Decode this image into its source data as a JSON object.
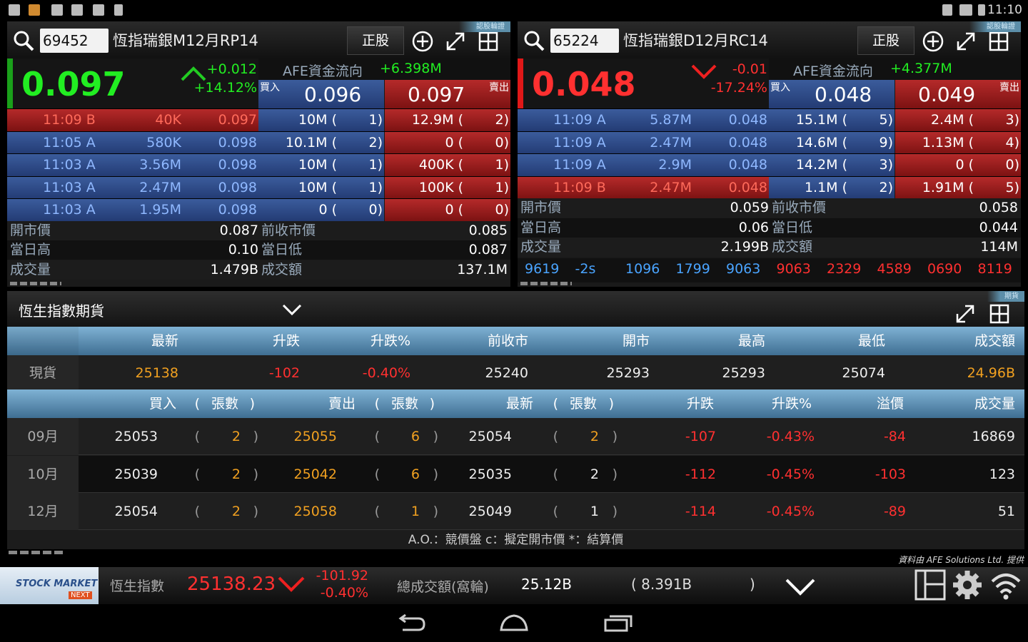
{
  "status_bar": {
    "time": "11:10"
  },
  "panels": [
    {
      "code": "69452",
      "name": "恆指瑞銀M12月RP14",
      "button": "正股",
      "tag": "認股輪證",
      "price": "0.097",
      "change": "+0.012",
      "change_pct": "+14.12%",
      "afe_label": "AFE資金流向",
      "afe_value": "+6.398M",
      "bid_label": "買入",
      "ask_label": "賣出",
      "bid": "0.096",
      "ask": "0.097",
      "trades": [
        {
          "time": "11:09 B",
          "vol": "40K",
          "price": "0.097",
          "side": "red"
        },
        {
          "time": "11:05 A",
          "vol": "580K",
          "price": "0.098",
          "side": "blue"
        },
        {
          "time": "11:03 A",
          "vol": "3.56M",
          "price": "0.098",
          "side": "blue"
        },
        {
          "time": "11:03 A",
          "vol": "2.47M",
          "price": "0.098",
          "side": "blue"
        },
        {
          "time": "11:03 A",
          "vol": "1.95M",
          "price": "0.098",
          "side": "blue"
        }
      ],
      "bids": [
        [
          "10M (",
          "1)"
        ],
        [
          "10.1M (",
          "2)"
        ],
        [
          "10M (",
          "1)"
        ],
        [
          "10M (",
          "1)"
        ],
        [
          "0 (",
          "0)"
        ]
      ],
      "asks": [
        [
          "12.9M (",
          "2)"
        ],
        [
          "0 (",
          "0)"
        ],
        [
          "400K (",
          "1)"
        ],
        [
          "100K (",
          "1)"
        ],
        [
          "0 (",
          "0)"
        ]
      ],
      "stats": [
        {
          "l1": "開市價",
          "v1": "0.087",
          "l2": "前收市價",
          "v2": "0.085"
        },
        {
          "l1": "當日高",
          "v1": "0.10",
          "l2": "當日低",
          "v2": "0.087"
        },
        {
          "l1": "成交量",
          "v1": "1.479B",
          "l2": "成交額",
          "v2": "137.1M"
        }
      ]
    },
    {
      "code": "65224",
      "name": "恆指瑞銀D12月RC14",
      "button": "正股",
      "tag": "認股輪證",
      "price": "0.048",
      "change": "-0.01",
      "change_pct": "-17.24%",
      "afe_label": "AFE資金流向",
      "afe_value": "+4.377M",
      "bid_label": "買入",
      "ask_label": "賣出",
      "bid": "0.048",
      "ask": "0.049",
      "trades": [
        {
          "time": "11:09 A",
          "vol": "5.87M",
          "price": "0.048",
          "side": "blue"
        },
        {
          "time": "11:09 A",
          "vol": "2.47M",
          "price": "0.048",
          "side": "blue"
        },
        {
          "time": "11:09 A",
          "vol": "2.9M",
          "price": "0.048",
          "side": "blue"
        },
        {
          "time": "11:09 B",
          "vol": "2.47M",
          "price": "0.048",
          "side": "red"
        }
      ],
      "bids": [
        [
          "15.1M (",
          "5)"
        ],
        [
          "14.6M (",
          "9)"
        ],
        [
          "14.2M (",
          "3)"
        ],
        [
          "1.1M (",
          "2)"
        ]
      ],
      "asks": [
        [
          "2.4M (",
          "3)"
        ],
        [
          "1.13M (",
          "4)"
        ],
        [
          "0 (",
          "0)"
        ],
        [
          "1.91M (",
          "5)"
        ]
      ],
      "stats": [
        {
          "l1": "開市價",
          "v1": "0.059",
          "l2": "前收市價",
          "v2": "0.058"
        },
        {
          "l1": "當日高",
          "v1": "0.06",
          "l2": "當日低",
          "v2": "0.044"
        },
        {
          "l1": "成交量",
          "v1": "2.199B",
          "l2": "成交額",
          "v2": "114M"
        }
      ],
      "brokers": [
        {
          "v": "9619",
          "c": "#4aa4ff"
        },
        {
          "v": "-2s",
          "c": "#4aa4ff"
        },
        {
          "v": "1096",
          "c": "#4aa4ff"
        },
        {
          "v": "1799",
          "c": "#4aa4ff"
        },
        {
          "v": "9063",
          "c": "#4aa4ff"
        },
        {
          "v": "9063",
          "c": "#ff3030"
        },
        {
          "v": "2329",
          "c": "#ff3030"
        },
        {
          "v": "4589",
          "c": "#ff3030"
        },
        {
          "v": "0690",
          "c": "#ff3030"
        },
        {
          "v": "8119",
          "c": "#ff3030"
        }
      ]
    }
  ],
  "futures": {
    "title": "恆生指數期貨",
    "tag": "期貨",
    "spot_headers": [
      "最新",
      "升跌",
      "升跌%",
      "前收市",
      "開市",
      "最高",
      "最低",
      "成交額"
    ],
    "spot": {
      "label": "現貨",
      "values": [
        "25138",
        "-102",
        "-0.40%",
        "25240",
        "25293",
        "25293",
        "25074",
        "24.96B"
      ]
    },
    "fut_headers": {
      "bid": "買入",
      "ask": "賣出",
      "last": "最新",
      "lots": "張數",
      "open": "(",
      "close": ")",
      "chg": "升跌",
      "chg_pct": "升跌%",
      "premium": "溢價",
      "volume": "成交量"
    },
    "rows": [
      {
        "month": "09月",
        "bid": "25053",
        "bid_lots": "2",
        "ask": "25055",
        "ask_lots": "6",
        "last": "25054",
        "last_lots": "2",
        "chg": "-107",
        "chg_pct": "-0.43%",
        "premium": "-84",
        "volume": "16869"
      },
      {
        "month": "10月",
        "bid": "25039",
        "bid_lots": "2",
        "ask": "25042",
        "ask_lots": "6",
        "last": "25035",
        "last_lots": "2",
        "chg": "-112",
        "chg_pct": "-0.45%",
        "premium": "-103",
        "volume": "123"
      },
      {
        "month": "12月",
        "bid": "25054",
        "bid_lots": "2",
        "ask": "25058",
        "ask_lots": "1",
        "last": "25049",
        "last_lots": "1",
        "chg": "-114",
        "chg_pct": "-0.45%",
        "premium": "-89",
        "volume": "51"
      }
    ],
    "legend": "A.O.：競價盤    c：擬定開市價    *：結算價",
    "credit": "資料由 AFE Solutions Ltd. 提供"
  },
  "bottom_bar": {
    "logo_line1": "STOCK MARKET",
    "logo_line2": "NEXT",
    "index_label": "恆生指數",
    "index_value": "25138.23",
    "index_change": "-101.92",
    "index_change_pct": "-0.40%",
    "turnover_label": "總成交額(窩輪)",
    "turnover": "25.12B",
    "turnover_warrant": "( 8.391B",
    "turnover_close": ")"
  }
}
